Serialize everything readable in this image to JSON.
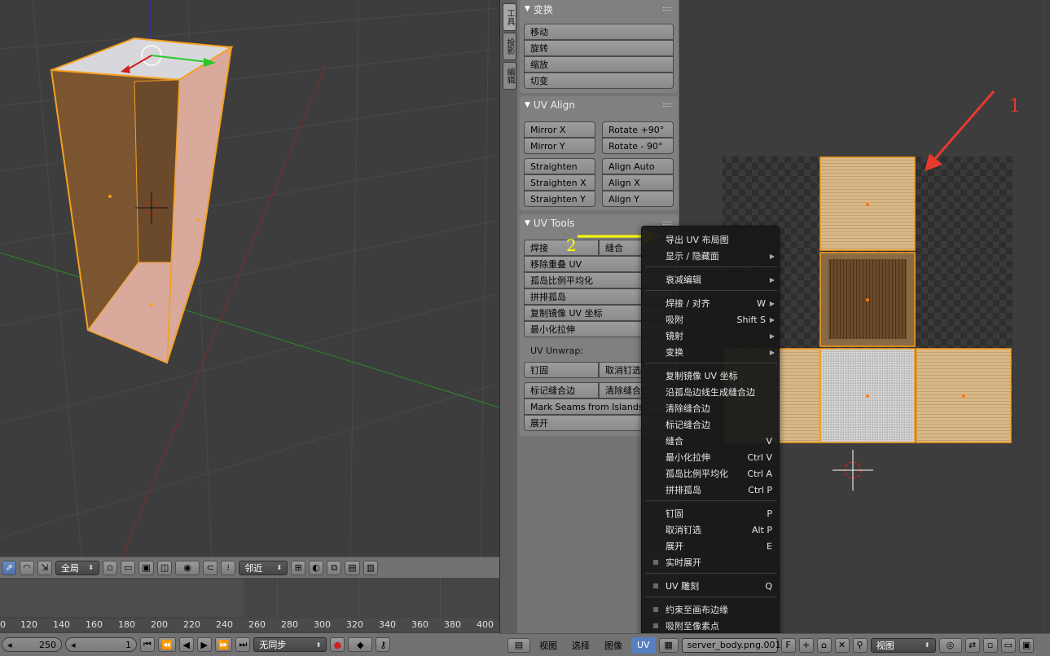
{
  "viewport3d": {
    "header": {
      "pivot_select": "全局",
      "snap_select": "邻近"
    },
    "timeline": {
      "ticks": [
        "0",
        "120",
        "140",
        "160",
        "180",
        "200",
        "220",
        "240",
        "260",
        "280",
        "300",
        "320",
        "340",
        "360",
        "380",
        "400"
      ]
    },
    "playback": {
      "end_frame": "250",
      "current_frame": "1",
      "sync_select": "无同步"
    }
  },
  "toolshelf": {
    "tabs": [
      "工具",
      "投影",
      "编辑"
    ],
    "transform_panel": {
      "title": "变换",
      "buttons": [
        "移动",
        "旋转",
        "缩放",
        "切变"
      ]
    },
    "uv_align_panel": {
      "title": "UV Align",
      "buttons": [
        "Mirror X",
        "Rotate +90°",
        "Mirror Y",
        "Rotate  - 90°",
        "Straighten",
        "Align Auto",
        "Straighten X",
        "Align X",
        "Straighten Y",
        "Align Y"
      ]
    },
    "uv_tools_panel": {
      "title": "UV Tools",
      "weld": "焊接",
      "stitch": "缝合",
      "remove_doubles": "移除重叠 UV",
      "average_islands": "孤岛比例平均化",
      "pack_islands": "拼排孤岛",
      "copy_mirrored": "复制镜像 UV 坐标",
      "minimize_stretch": "最小化拉伸",
      "unwrap_label": "UV Unwrap:",
      "pin": "钉固",
      "unpin": "取消钉选",
      "mark_seam": "标记缝合边",
      "clear_seam": "清除缝合边",
      "seams_from_islands": "Mark Seams from Islands",
      "unwrap": "展开"
    }
  },
  "annotations": {
    "label_1": "1",
    "label_2": "2"
  },
  "uv_menu": {
    "items": [
      {
        "label": "导出 UV 布局图",
        "shortcut": "",
        "submenu": false
      },
      {
        "label": "显示 / 隐藏面",
        "shortcut": "",
        "submenu": true
      },
      {
        "label": "衰减编辑",
        "shortcut": "",
        "submenu": true
      },
      {
        "label": "焊接 / 对齐",
        "shortcut": "W",
        "submenu": true
      },
      {
        "label": "吸附",
        "shortcut": "Shift S",
        "submenu": true
      },
      {
        "label": "镜射",
        "shortcut": "",
        "submenu": true
      },
      {
        "label": "变换",
        "shortcut": "",
        "submenu": true
      },
      {
        "label": "复制镜像 UV 坐标",
        "shortcut": "",
        "submenu": false
      },
      {
        "label": "沿孤岛边线生成缝合边",
        "shortcut": "",
        "submenu": false
      },
      {
        "label": "清除缝合边",
        "shortcut": "",
        "submenu": false
      },
      {
        "label": "标记缝合边",
        "shortcut": "",
        "submenu": false
      },
      {
        "label": "缝合",
        "shortcut": "V",
        "submenu": false
      },
      {
        "label": "最小化拉伸",
        "shortcut": "Ctrl V",
        "submenu": false
      },
      {
        "label": "孤岛比例平均化",
        "shortcut": "Ctrl A",
        "submenu": false
      },
      {
        "label": "拼排孤岛",
        "shortcut": "Ctrl P",
        "submenu": false
      },
      {
        "label": "钉固",
        "shortcut": "P",
        "submenu": false
      },
      {
        "label": "取消钉选",
        "shortcut": "Alt P",
        "submenu": false
      },
      {
        "label": "展开",
        "shortcut": "E",
        "submenu": false
      },
      {
        "label": "实时展开",
        "shortcut": "",
        "submenu": false,
        "checkbox": true
      },
      {
        "label": "UV 雕刻",
        "shortcut": "Q",
        "submenu": false,
        "checkbox": true
      },
      {
        "label": "约束至画布边缘",
        "shortcut": "",
        "submenu": false,
        "checkbox": true
      },
      {
        "label": "吸附至像素点",
        "shortcut": "",
        "submenu": false,
        "checkbox": true
      }
    ]
  },
  "uv_header": {
    "menus": [
      "视图",
      "选择",
      "图像",
      "UV"
    ],
    "active_menu": "UV",
    "image_name": "server_body.png.001",
    "fake_user": "F",
    "view_select": "视图"
  },
  "colors": {
    "accent_blue": "#5680c2",
    "annotation_red": "#e8392e",
    "annotation_yellow": "#ffff00",
    "selection_orange": "#f5a020"
  }
}
